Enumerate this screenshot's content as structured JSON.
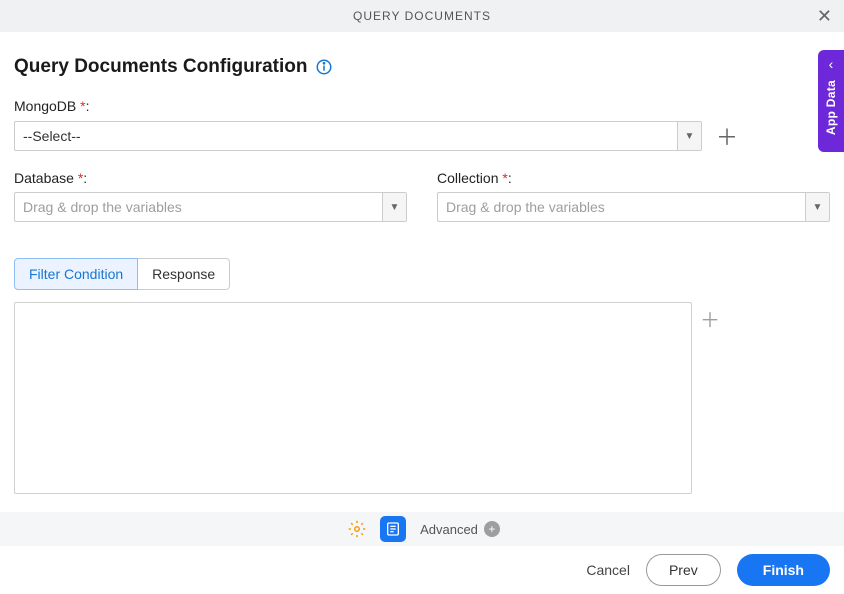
{
  "header": {
    "title": "QUERY DOCUMENTS"
  },
  "page": {
    "title": "Query Documents Configuration"
  },
  "sideTab": {
    "label": "App Data"
  },
  "fields": {
    "mongodb": {
      "label": "MongoDB ",
      "value": "--Select--",
      "asterisk": "*"
    },
    "database": {
      "label": "Database ",
      "placeholder": "Drag & drop the variables",
      "asterisk": "*"
    },
    "collection": {
      "label": "Collection ",
      "placeholder": "Drag & drop the variables",
      "asterisk": "*"
    }
  },
  "tabs": {
    "filter": "Filter Condition",
    "response": "Response"
  },
  "toolbar": {
    "advanced": "Advanced"
  },
  "actions": {
    "cancel": "Cancel",
    "prev": "Prev",
    "finish": "Finish"
  },
  "colors": {
    "primary": "#1976f2",
    "sidebar": "#6d28d9",
    "danger": "#d32f2f"
  }
}
